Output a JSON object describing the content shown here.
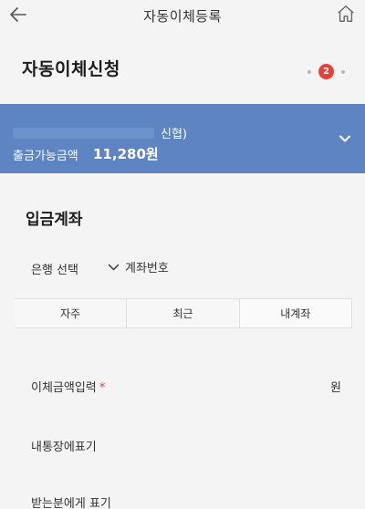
{
  "nav": {
    "title": "자동이체등록"
  },
  "header": {
    "title": "자동이체신청",
    "step": "2"
  },
  "account": {
    "bank": "신협)",
    "available_label": "출금가능금액",
    "available_amount": "11,280원"
  },
  "deposit": {
    "section_title": "입금계좌",
    "bank_select": "은행 선택",
    "account_select": "계좌번호",
    "tabs": [
      "자주",
      "최근",
      "내계좌"
    ],
    "amount_label": "이체금액입력",
    "amount_required": "*",
    "amount_unit": "원",
    "my_memo": "내통장에표기",
    "recipient_memo": "받는분에게 표기"
  }
}
